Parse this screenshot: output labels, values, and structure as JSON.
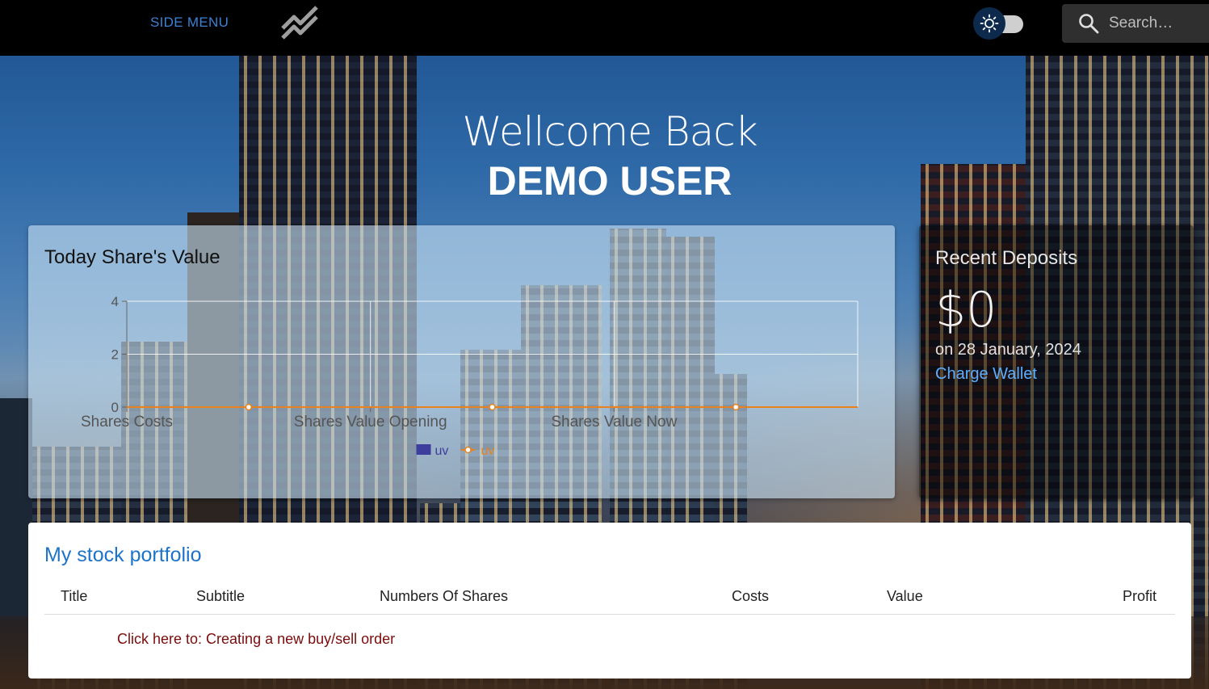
{
  "topbar": {
    "side_menu_label": "SIDE MENU",
    "logo_icon": "trending-chart-icon",
    "theme_icon": "sun-icon",
    "search_placeholder": "Search…"
  },
  "hero": {
    "greeting": "Wellcome Back",
    "username": "DEMO USER"
  },
  "share_chart": {
    "title": "Today Share's Value"
  },
  "chart_data": {
    "type": "line",
    "categories": [
      "Shares Costs",
      "Shares Value Opening",
      "Shares Value Now"
    ],
    "series": [
      {
        "name": "uv",
        "kind": "bar",
        "color": "#3d3d9e",
        "values": [
          0,
          0,
          0
        ]
      },
      {
        "name": "uv",
        "kind": "line",
        "color": "#e8821e",
        "values": [
          0,
          0,
          0
        ]
      }
    ],
    "y_ticks": [
      0,
      2,
      4
    ],
    "ylim": [
      0,
      4
    ],
    "grid": true,
    "legend": "bottom-center"
  },
  "deposits": {
    "title": "Recent Deposits",
    "amount": "$0",
    "date": "on 28 January, 2024",
    "link": "Charge Wallet"
  },
  "portfolio": {
    "title": "My stock portfolio",
    "columns": [
      "Title",
      "Subtitle",
      "Numbers Of Shares",
      "Costs",
      "Value",
      "Profit"
    ],
    "rows": [],
    "order_link": "Click here to: Creating a new buy/sell order"
  },
  "colors": {
    "accent": "#1e73c8",
    "link_dark_red": "#7a0c0c",
    "topbar": "#000000"
  }
}
